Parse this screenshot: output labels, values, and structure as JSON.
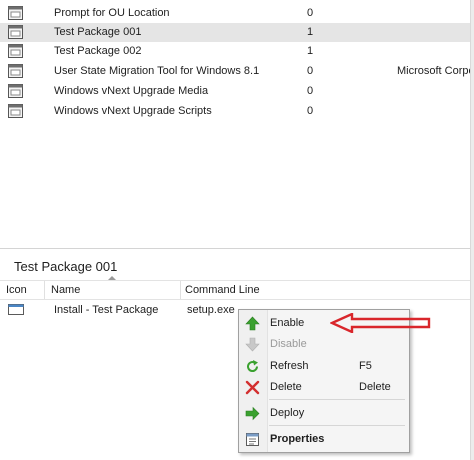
{
  "packages": [
    {
      "name": "Prompt for OU Location",
      "count": "0",
      "maker": "",
      "selected": false
    },
    {
      "name": "Test Package 001",
      "count": "1",
      "maker": "",
      "selected": true
    },
    {
      "name": "Test Package 002",
      "count": "1",
      "maker": "",
      "selected": false
    },
    {
      "name": "User State Migration Tool for Windows 8.1",
      "count": "0",
      "maker": "Microsoft Corpo",
      "selected": false
    },
    {
      "name": "Windows vNext Upgrade Media",
      "count": "0",
      "maker": "",
      "selected": false
    },
    {
      "name": "Windows vNext Upgrade Scripts",
      "count": "0",
      "maker": "",
      "selected": false
    }
  ],
  "details": {
    "title": "Test Package 001",
    "columns": {
      "icon": "Icon",
      "name": "Name",
      "command": "Command Line"
    },
    "rows": [
      {
        "name": "Install - Test Package",
        "command": "setup.exe"
      }
    ]
  },
  "context_menu": {
    "items": [
      {
        "label": "Enable",
        "icon": "green-up-arrow-icon",
        "enabled": true
      },
      {
        "label": "Disable",
        "icon": "gray-down-arrow-icon",
        "enabled": false
      },
      {
        "label": "Refresh",
        "shortcut": "F5",
        "icon": "refresh-icon",
        "enabled": true
      },
      {
        "label": "Delete",
        "shortcut": "Delete",
        "icon": "delete-x-icon",
        "enabled": true
      },
      {
        "label": "Deploy",
        "icon": "deploy-arrow-icon",
        "enabled": true
      },
      {
        "label": "Properties",
        "icon": "properties-icon",
        "enabled": true,
        "bold": true
      }
    ]
  },
  "colors": {
    "selection": "#e5e5e5",
    "annotation_arrow": "#d9262b",
    "enable_green": "#3aa12f"
  }
}
